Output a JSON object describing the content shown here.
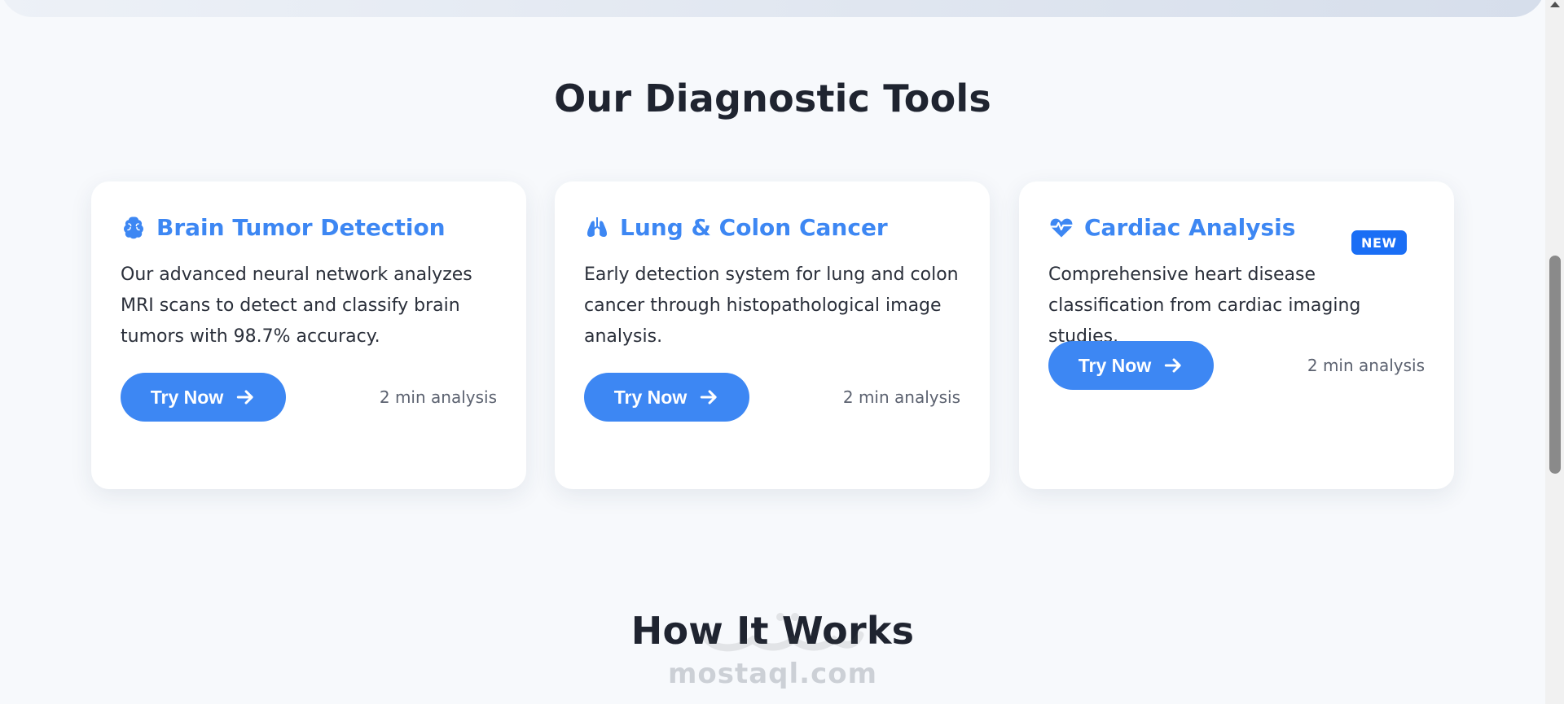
{
  "sections": {
    "tools_title": "Our Diagnostic Tools",
    "works_title": "How It Works"
  },
  "cards": [
    {
      "icon": "brain-icon",
      "title": "Brain Tumor Detection",
      "description": "Our advanced neural network analyzes MRI scans to detect and classify brain tumors with 98.7% accuracy.",
      "button_label": "Try Now",
      "meta": "2 min analysis"
    },
    {
      "icon": "lungs-icon",
      "title": "Lung & Colon Cancer",
      "description": "Early detection system for lung and colon cancer through histopathological image analysis.",
      "button_label": "Try Now",
      "meta": "2 min analysis"
    },
    {
      "icon": "heart-pulse-icon",
      "title": "Cardiac Analysis",
      "badge": "NEW",
      "description": "Comprehensive heart disease classification from cardiac imaging studies.",
      "button_label": "Try Now",
      "meta": "2 min analysis"
    }
  ],
  "watermark": {
    "text": "mostaql.com",
    "arabic": "مستقل"
  },
  "colors": {
    "accent": "#3d87f3",
    "badge": "#1a6ef5",
    "background": "#f7f9fc"
  }
}
